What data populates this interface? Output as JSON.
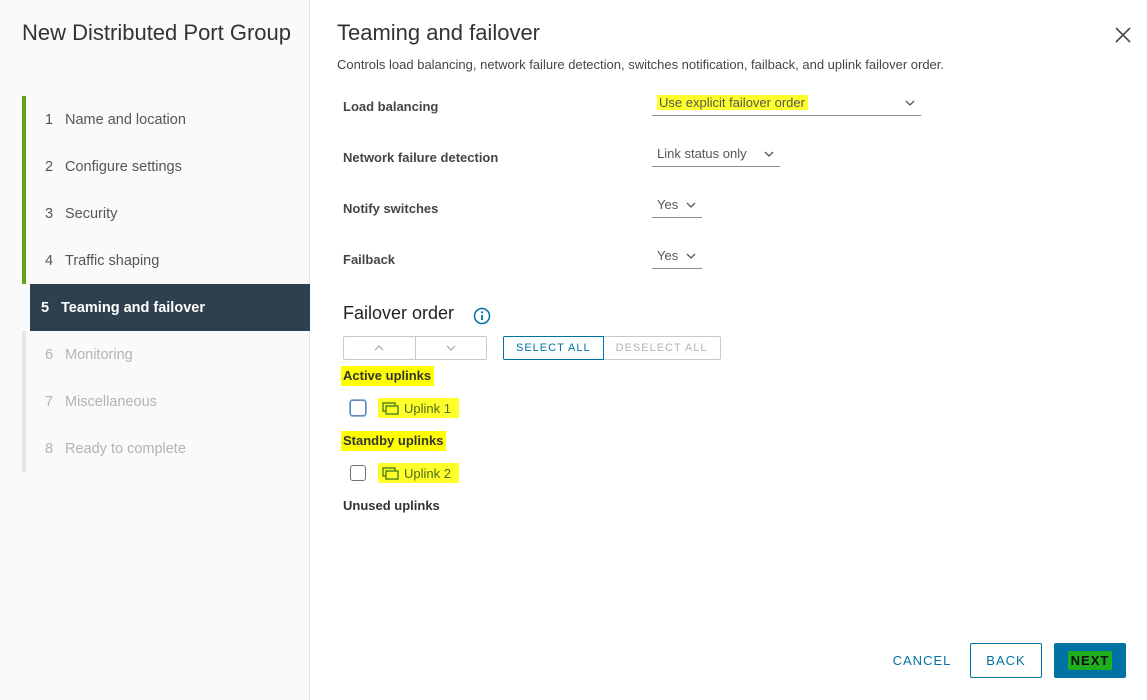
{
  "wizard": {
    "title": "New Distributed Port Group",
    "steps": [
      {
        "num": "1",
        "label": "Name and location",
        "state": "done"
      },
      {
        "num": "2",
        "label": "Configure settings",
        "state": "done"
      },
      {
        "num": "3",
        "label": "Security",
        "state": "done"
      },
      {
        "num": "4",
        "label": "Traffic shaping",
        "state": "done"
      },
      {
        "num": "5",
        "label": "Teaming and failover",
        "state": "active"
      },
      {
        "num": "6",
        "label": "Monitoring",
        "state": "disabled"
      },
      {
        "num": "7",
        "label": "Miscellaneous",
        "state": "disabled"
      },
      {
        "num": "8",
        "label": "Ready to complete",
        "state": "disabled"
      }
    ]
  },
  "page": {
    "title": "Teaming and failover",
    "description": "Controls load balancing, network failure detection, switches notification, failback, and uplink failover order."
  },
  "form": {
    "load_balancing": {
      "label": "Load balancing",
      "value": "Use explicit failover order"
    },
    "network_failure_detection": {
      "label": "Network failure detection",
      "value": "Link status only"
    },
    "notify_switches": {
      "label": "Notify switches",
      "value": "Yes"
    },
    "failback": {
      "label": "Failback",
      "value": "Yes"
    }
  },
  "failover": {
    "title": "Failover order",
    "select_all": "SELECT ALL",
    "deselect_all": "DESELECT ALL",
    "active_label": "Active uplinks",
    "standby_label": "Standby uplinks",
    "unused_label": "Unused uplinks",
    "active_uplinks": [
      {
        "name": "Uplink 1",
        "checked": false
      }
    ],
    "standby_uplinks": [
      {
        "name": "Uplink 2",
        "checked": false
      }
    ]
  },
  "footer": {
    "cancel": "CANCEL",
    "back": "BACK",
    "next": "NEXT"
  },
  "colors": {
    "accent": "#0072a3",
    "active_step_bg": "#2e3f4e",
    "step_done_bar": "#62a420",
    "highlight": "#ffff00"
  },
  "icons": {
    "close": "close-icon",
    "chevron": "chevron-down-icon",
    "info": "info-icon",
    "uplink": "uplink-icon",
    "move_up": "arrow-up-icon",
    "move_down": "arrow-down-icon"
  }
}
